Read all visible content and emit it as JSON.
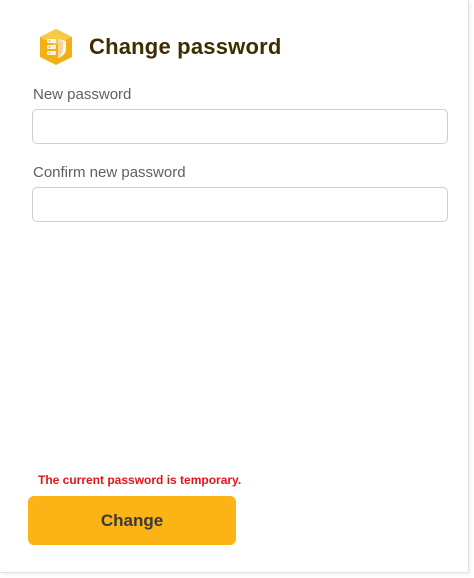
{
  "header": {
    "title": "Change password",
    "icon": "server-shield-icon",
    "icon_color": "#f3b015"
  },
  "form": {
    "new_password": {
      "label": "New password",
      "value": "",
      "placeholder": ""
    },
    "confirm_password": {
      "label": "Confirm new password",
      "value": "",
      "placeholder": ""
    }
  },
  "status": {
    "message": "The current password is temporary.",
    "color": "#e0151b"
  },
  "actions": {
    "submit_label": "Change",
    "accent": "#fbb316"
  }
}
